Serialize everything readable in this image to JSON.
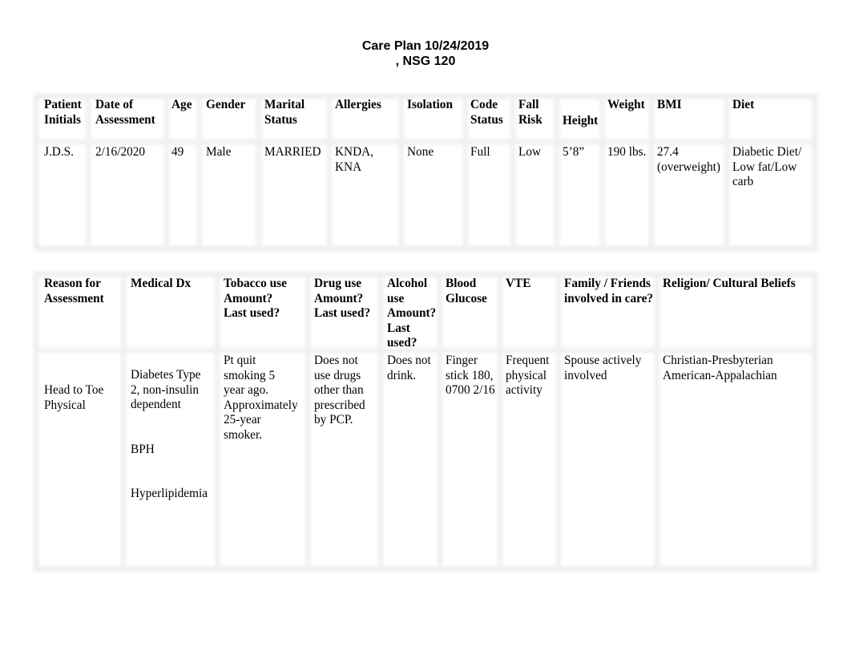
{
  "title_line1": "Care Plan 10/24/2019",
  "title_line2": ", NSG 120",
  "table1": {
    "headers": [
      "Patient\nInitials",
      "Date of\nAssessment",
      "Age",
      "Gender",
      "Marital\nStatus",
      "Allergies",
      "Isolation",
      "Code\nStatus",
      "Fall\nRisk",
      "Height",
      "Weight",
      "BMI",
      "Diet"
    ],
    "row": [
      "J.D.S.",
      "2/16/2020",
      "49",
      "Male",
      "MARRIED",
      "KNDA,\nKNA",
      "None",
      "Full",
      "Low",
      "5’8”",
      "190 lbs.",
      "27.4\n(overweight)",
      "Diabetic Diet/\nLow fat/Low\ncarb"
    ]
  },
  "table2": {
    "headers": [
      "Reason for\nAssessment",
      "Medical Dx",
      "Tobacco use\nAmount?\nLast used?",
      "Drug use\nAmount?\nLast used?",
      "Alcohol\nuse\nAmount?\nLast\nused?",
      "Blood\nGlucose",
      "VTE",
      "Family / Friends\ninvolved in care?",
      "Religion/ Cultural Beliefs"
    ],
    "row": [
      "Head to Toe\nPhysical",
      "Diabetes Type\n2, non-insulin\ndependent\n\n\nBPH\n\n\nHyperlipidemia",
      "Pt quit\nsmoking 5\nyear ago.\nApproximately\n25-year\nsmoker.",
      "Does not\nuse drugs\nother than\nprescribed\nby PCP.",
      "Does not\ndrink.",
      "Finger\nstick 180,\n0700 2/16",
      "Frequent\nphysical\nactivity",
      "Spouse actively\ninvolved",
      "Christian-Presbyterian\nAmerican-Appalachian"
    ]
  }
}
